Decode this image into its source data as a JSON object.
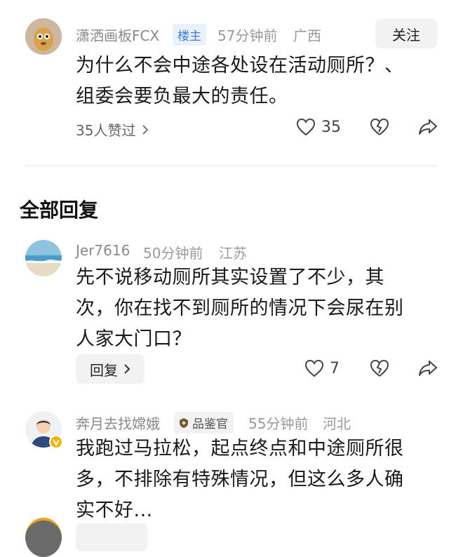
{
  "comments": [
    {
      "username": "潇洒画板FCX",
      "badge": "楼主",
      "time": "57分钟前",
      "location": "广西",
      "follow_label": "关注",
      "content_lines": [
        "为什么不会中途各处设在活动厕所？、",
        "组委会要负最大的责任。"
      ],
      "likes_summary": "35人赞过",
      "like_count": "35"
    },
    {
      "username": "Jer7616",
      "time": "50分钟前",
      "location": "江苏",
      "content_lines": [
        "先不说移动厕所其实设置了不少，其",
        "次，你在找不到厕所的情况下会尿在别",
        "人家大门口？"
      ],
      "reply_label": "回复",
      "like_count": "7"
    },
    {
      "username": "奔月去找嫦娥",
      "badge": "品鉴官",
      "time": "55分钟前",
      "location": "河北",
      "content_lines": [
        "我跑过马拉松，起点终点和中途厕所很",
        "多，不排除有特殊情况，但这么多人确",
        "实不好..."
      ]
    }
  ],
  "section_title": "全部回复",
  "colors": {
    "badge_blue": "#3d7fd6",
    "muted_text": "#9a9a9a",
    "verified_yellow": "#f0b400"
  }
}
